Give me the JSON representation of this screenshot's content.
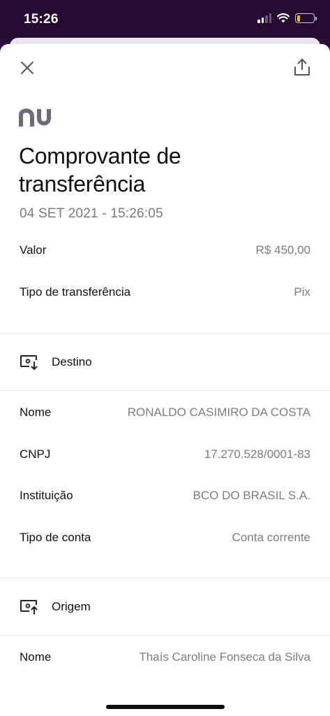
{
  "status_bar": {
    "time": "15:26"
  },
  "header": {
    "close_icon": "close-icon",
    "share_icon": "share-icon",
    "logo_text": "nu"
  },
  "receipt": {
    "title": "Comprovante de transferência",
    "date": "04 SET 2021 - 15:26:05",
    "summary": [
      {
        "label": "Valor",
        "value": "R$ 450,00"
      },
      {
        "label": "Tipo de transferência",
        "value": "Pix"
      }
    ],
    "destination": {
      "section_label": "Destino",
      "icon": "destination-icon",
      "rows": [
        {
          "label": "Nome",
          "value": "RONALDO CASIMIRO DA COSTA"
        },
        {
          "label": "CNPJ",
          "value": "17.270.528/0001-83"
        },
        {
          "label": "Instituição",
          "value": "BCO DO BRASIL S.A."
        },
        {
          "label": "Tipo de conta",
          "value": "Conta corrente"
        }
      ]
    },
    "origin": {
      "section_label": "Origem",
      "icon": "origin-icon",
      "rows": [
        {
          "label": "Nome",
          "value": "Thaís Caroline Fonseca da Silva"
        }
      ]
    }
  },
  "colors": {
    "status_bar_bg": "#250b33",
    "logo": "#6e6a7a",
    "value_text": "#7d7d7d",
    "battery_level": "#f2c300"
  }
}
